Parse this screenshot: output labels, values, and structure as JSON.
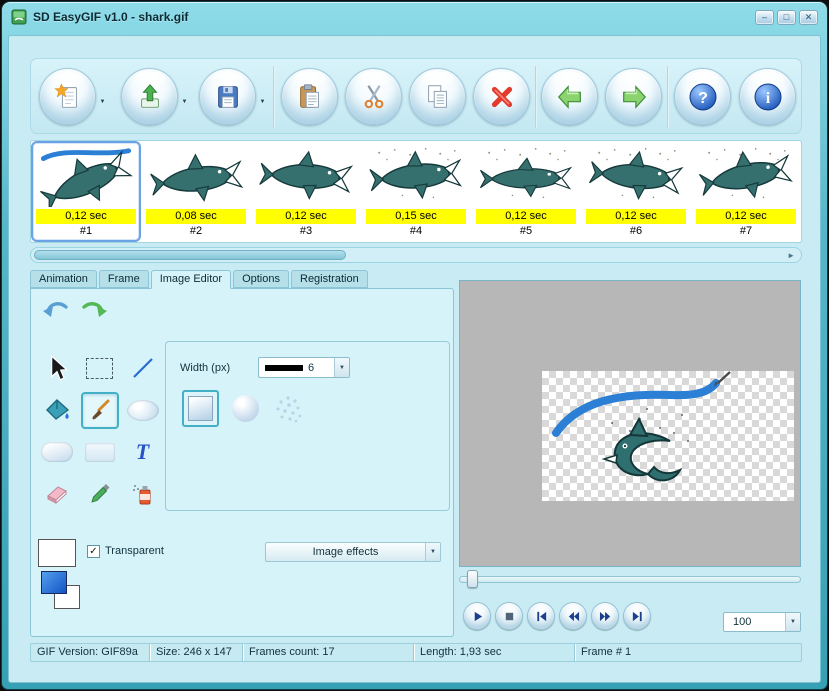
{
  "window": {
    "title": "SD EasyGIF v1.0 - shark.gif"
  },
  "icons": {
    "minimize": "–",
    "maximize": "□",
    "close": "✕",
    "dropdown": "▼",
    "help": "?",
    "info": "i",
    "scroll_right": "►",
    "checkmark": "✓"
  },
  "toolbar": {
    "buttons": [
      {
        "name": "new",
        "has_dropdown": true
      },
      {
        "name": "open",
        "has_dropdown": true
      },
      {
        "name": "save",
        "has_dropdown": true
      },
      {
        "name": "paste",
        "has_dropdown": false
      },
      {
        "name": "cut",
        "has_dropdown": false
      },
      {
        "name": "copy",
        "has_dropdown": false
      },
      {
        "name": "delete",
        "has_dropdown": false
      },
      {
        "name": "back",
        "has_dropdown": false
      },
      {
        "name": "forward",
        "has_dropdown": false
      },
      {
        "name": "help",
        "has_dropdown": false
      },
      {
        "name": "info",
        "has_dropdown": false
      }
    ]
  },
  "frame_strip": {
    "selected_frame": 1,
    "frames": [
      {
        "duration": "0,12 sec",
        "number": "#1"
      },
      {
        "duration": "0,08 sec",
        "number": "#2"
      },
      {
        "duration": "0,12 sec",
        "number": "#3"
      },
      {
        "duration": "0,15 sec",
        "number": "#4"
      },
      {
        "duration": "0,12 sec",
        "number": "#5"
      },
      {
        "duration": "0,12 sec",
        "number": "#6"
      },
      {
        "duration": "0,12 sec",
        "number": "#7"
      }
    ]
  },
  "tabs": [
    {
      "label": "Animation",
      "selected": false
    },
    {
      "label": "Frame",
      "selected": false
    },
    {
      "label": "Image Editor",
      "selected": true
    },
    {
      "label": "Options",
      "selected": false
    },
    {
      "label": "Registration",
      "selected": false
    }
  ],
  "editor": {
    "selected_tool": "brush",
    "width_label": "Width (px)",
    "width_value": "6",
    "text_tool_glyph": "T",
    "transparent_label": "Transparent",
    "transparent_checked": true,
    "image_effects_label": "Image effects",
    "foreground_color": "#1e5fd0",
    "background_color": "#ffffff"
  },
  "preview": {
    "zoom_value": "100",
    "playback_buttons": [
      "play",
      "stop",
      "first",
      "rewind",
      "fast-forward",
      "last"
    ]
  },
  "statusbar": {
    "segments": [
      "GIF Version: GIF89a",
      "Size: 246 x 147",
      "Frames count: 17",
      "Length: 1,93 sec",
      "Frame # 1"
    ]
  },
  "colors": {
    "frame_accent_teal": "#3aa2b6",
    "selection_blue": "#6aa2e4",
    "duration_yellow": "#ffff00"
  }
}
